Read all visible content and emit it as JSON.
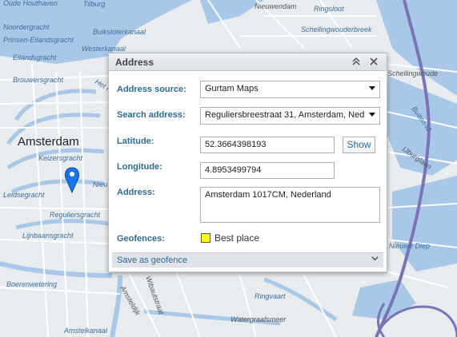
{
  "map": {
    "city": "Amsterdam",
    "streets": [
      "Oude Houthaven",
      "Tilburg",
      "Nieuwendam",
      "Ringsloot",
      "Noordergracht",
      "Buiksloterkanaal",
      "Schellingwouderbreek",
      "Prinsen-Eilandsgracht",
      "Westerkanaal",
      "Eilandsgracht",
      "Brouwersgracht",
      "Het IJ",
      "Amsterdam",
      "Keizersgracht",
      "Leidsegracht",
      "Nieuwe",
      "Reguliersgracht",
      "Lijnbaansgracht",
      "Boerenwetering",
      "Wibautstraat",
      "Ringvaart",
      "Watergraafsmeer",
      "Amsteldijk",
      "Amstelkanaal",
      "Buiten-IJ",
      "IJburglaan",
      "Nieuwe Diep",
      "Schellingwoude"
    ],
    "colors": {
      "water": "#a9c8e8",
      "land": "#e9ecef",
      "highway": "#7a73b8",
      "road": "#ffffff",
      "marker": "#1a73e8"
    }
  },
  "dialog": {
    "title": "Address",
    "collapse_icon": "double-chevron-up-icon",
    "close_icon": "close-icon",
    "fields": {
      "address_source": {
        "label": "Address source:",
        "value": "Gurtam Maps"
      },
      "search_address": {
        "label": "Search address:",
        "value": "Reguliersbreestraat 31, Amsterdam, Ned"
      },
      "latitude": {
        "label": "Latitude:",
        "value": "52.3664398193"
      },
      "longitude": {
        "label": "Longitude:",
        "value": "4.8953499794"
      },
      "address": {
        "label": "Address:",
        "value": "Amsterdam 1017CM, Nederland"
      },
      "geofences": {
        "label": "Geofences:",
        "value": "Best place",
        "color": "#ffff00"
      }
    },
    "show_button": "Show",
    "save_as_geofence": "Save as geofence"
  }
}
